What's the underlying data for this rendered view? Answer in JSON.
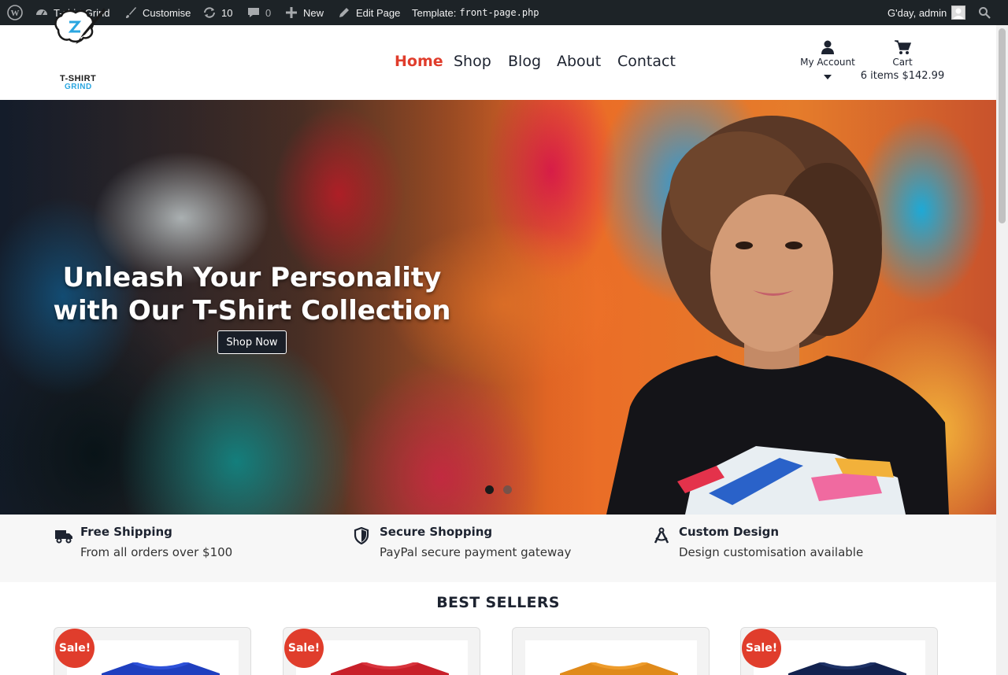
{
  "admin_bar": {
    "site_name": "T-shirt Grind",
    "customise": "Customise",
    "updates_count": "10",
    "comments_count": "0",
    "new_label": "New",
    "edit_page": "Edit Page",
    "template_label": "Template:",
    "template_file": "front-page.php",
    "greeting": "G'day, admin"
  },
  "header": {
    "logo_line1": "T-SHIRT",
    "logo_line2": "GRIND",
    "nav": [
      "Home",
      "Shop",
      "Blog",
      "About",
      "Contact"
    ],
    "active_nav": "Home",
    "account_label": "My Account",
    "cart_label": "Cart",
    "cart_summary": "6 items $142.99"
  },
  "hero": {
    "title_line1": "Unleash Your Personality",
    "title_line2": "with Our T-Shirt Collection",
    "cta": "Shop Now",
    "slides": 2,
    "active_slide": 1
  },
  "features": [
    {
      "icon": "truck-icon",
      "title": "Free Shipping",
      "subtitle": "From all orders over $100"
    },
    {
      "icon": "shield-icon",
      "title": "Secure Shopping",
      "subtitle": "PayPal secure payment gateway"
    },
    {
      "icon": "compass-icon",
      "title": "Custom Design",
      "subtitle": "Design customisation available"
    }
  ],
  "best_sellers": {
    "title": "BEST SELLERS",
    "sale_label": "Sale!",
    "products": [
      {
        "shirt_color": "#1f3fbf",
        "on_sale": true
      },
      {
        "shirt_color": "#c8202a",
        "on_sale": true
      },
      {
        "shirt_color": "#e08a1a",
        "on_sale": false
      },
      {
        "shirt_color": "#12224f",
        "on_sale": true
      }
    ]
  },
  "colors": {
    "accent": "#e03d2c",
    "text": "#1d2330",
    "admin_bar": "#1d2327"
  }
}
